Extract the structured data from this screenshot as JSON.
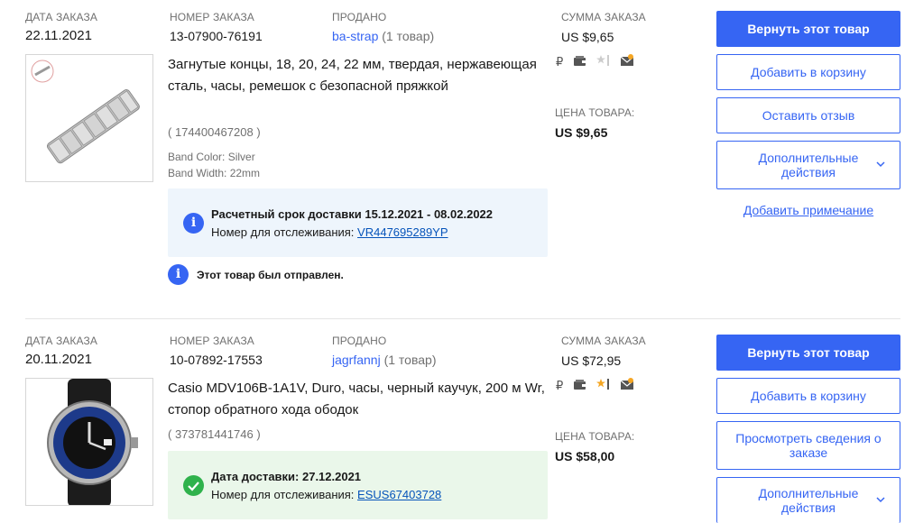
{
  "orders": [
    {
      "date_label": "ДАТА ЗАКАЗА",
      "date": "22.11.2021",
      "number_label": "НОМЕР ЗАКАЗА",
      "number": "13-07900-76191",
      "sold_label": "ПРОДАНО",
      "seller": "ba-strap",
      "seller_count": "(1 товар)",
      "total_label": "СУММА ЗАКАЗА",
      "total": "US $9,65",
      "title": "Загнутые концы, 18, 20, 24, 22 мм, твердая, нержавеющая сталь, часы, ремешок с безопасной пряжкой",
      "item_id": "( 174400467208 )",
      "spec_1": "Band Color: Silver",
      "spec_2": "Band Width: 22mm",
      "price_label": "ЦЕНА ТОВАРА:",
      "price": "US $9,65",
      "shipping_title": "Расчетный срок доставки 15.12.2021 - 08.02.2022",
      "tracking_label": "Номер для отслеживания:",
      "tracking": "VR447695289YP",
      "status_note": "Этот товар был отправлен.",
      "actions": {
        "return": "Вернуть этот товар",
        "add_to_cart": "Добавить в корзину",
        "feedback": "Оставить отзыв",
        "more": "Дополнительные действия",
        "add_note": "Добавить примечание"
      },
      "icons": [
        "ruble-icon",
        "wallet-icon",
        "star-icon",
        "envelope-icon"
      ]
    },
    {
      "date_label": "ДАТА ЗАКАЗА",
      "date": "20.11.2021",
      "number_label": "НОМЕР ЗАКАЗА",
      "number": "10-07892-17553",
      "sold_label": "ПРОДАНО",
      "seller": "jagrfannj",
      "seller_count": "(1 товар)",
      "total_label": "СУММА ЗАКАЗА",
      "total": "US $72,95",
      "title": "Casio MDV106B-1A1V, Duro, часы, черный каучук, 200 м Wr, стопор обратного хода ободок",
      "item_id": "( 373781441746 )",
      "price_label": "ЦЕНА ТОВАРА:",
      "price": "US $58,00",
      "shipping_title": "Дата доставки: 27.12.2021",
      "tracking_label": "Номер для отслеживания:",
      "tracking": "ESUS67403728",
      "actions": {
        "return": "Вернуть этот товар",
        "add_to_cart": "Добавить в корзину",
        "view_details": "Просмотреть сведения о заказе",
        "more": "Дополнительные действия"
      },
      "icons": [
        "ruble-icon",
        "wallet-icon",
        "star-icon",
        "envelope-icon"
      ]
    }
  ],
  "glyphs": {
    "ruble": "₽",
    "info": "i"
  },
  "colors": {
    "accent": "#3665f3",
    "link": "#0654ba",
    "success": "#2fb24c",
    "muted": "#707070"
  }
}
